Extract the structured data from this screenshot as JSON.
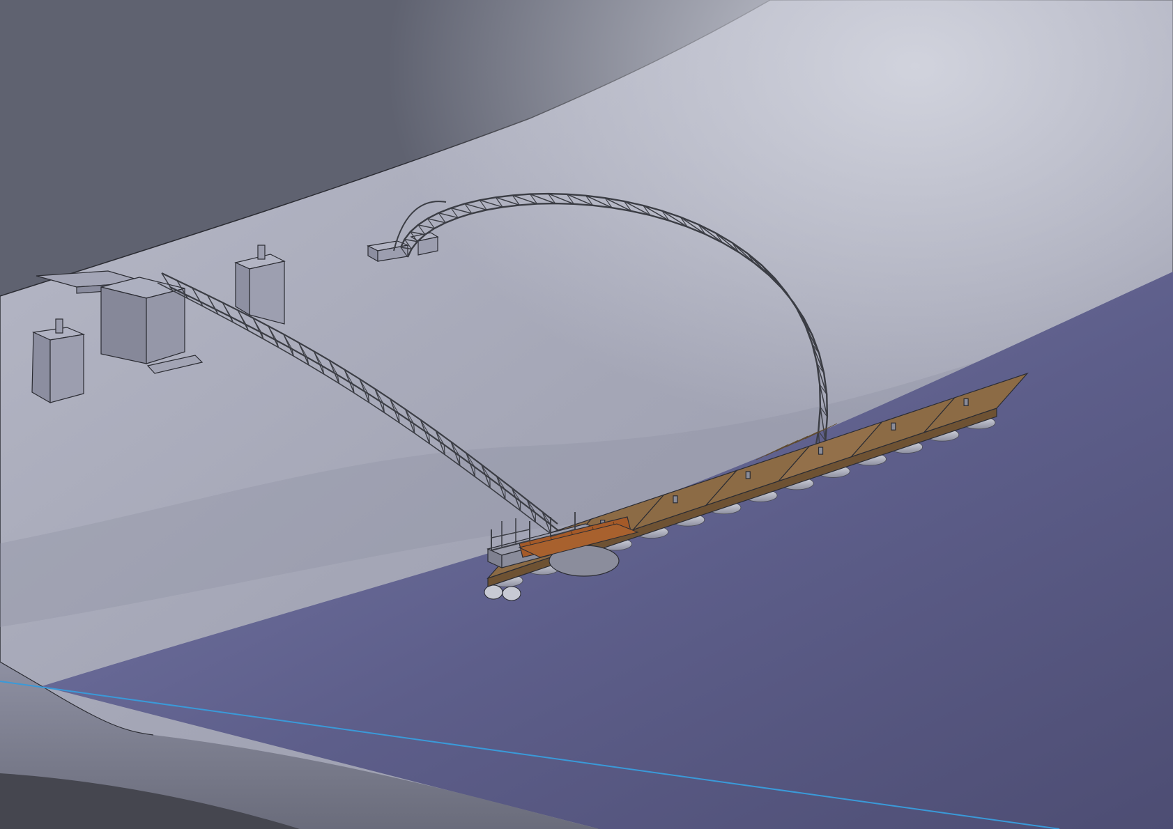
{
  "viewport": {
    "colors": {
      "terrain_dark": "#5f6270",
      "terrain_light": "#a7a9b8",
      "terrain_highlight": "#c4c6d2",
      "water": "#5a5b85",
      "water_light": "#7476a6",
      "steel": "#3b3d44",
      "block": "#9a9cad",
      "deck_wood": "#8c6b45",
      "deck_orange": "#a55a28",
      "float": "#c6c8d2",
      "waterline": "#3a9ad9"
    },
    "deck_modules": 7,
    "float_count": 14
  }
}
